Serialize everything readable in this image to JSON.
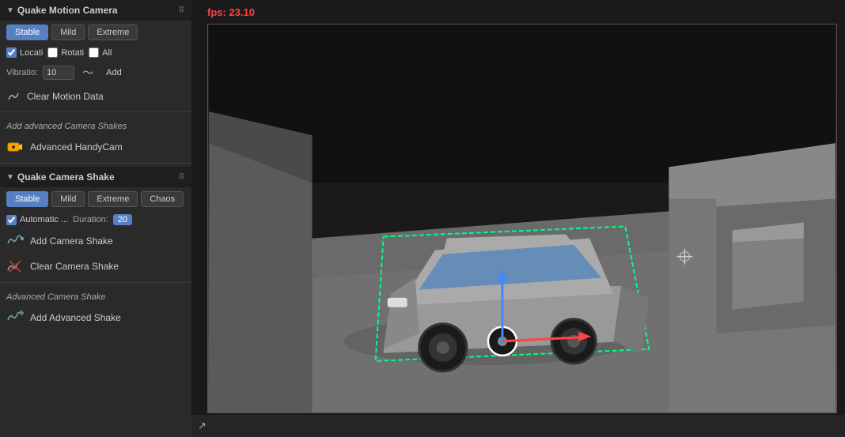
{
  "app": {
    "title": "Quake Motion Camera"
  },
  "fps": {
    "label": "fps:",
    "value": "23.10",
    "display": "fps: 23.10"
  },
  "quake_motion_section": {
    "title": "Quake Motion Camera",
    "drag_handle": "⠿",
    "tabs": [
      {
        "id": "stable",
        "label": "Stable",
        "active": true
      },
      {
        "id": "mild",
        "label": "Mild",
        "active": false
      },
      {
        "id": "extreme",
        "label": "Extreme",
        "active": false
      }
    ],
    "checkboxes": [
      {
        "id": "locati",
        "label": "Locati",
        "checked": true
      },
      {
        "id": "rotati",
        "label": "Rotati",
        "checked": false
      },
      {
        "id": "all",
        "label": "All",
        "checked": false
      }
    ],
    "vibration": {
      "label": "Vibratio:",
      "value": "10"
    },
    "add_button": "Add",
    "clear_motion": {
      "label": "Clear Motion Data",
      "icon": "curve-icon"
    }
  },
  "add_advanced_shakes": {
    "title": "Add advanced Camera Shakes",
    "handy_cam": {
      "label": "Advanced HandyCam",
      "icon": "camera-icon"
    }
  },
  "quake_camera_shake": {
    "title": "Quake Camera Shake",
    "drag_handle": "⠿",
    "tabs": [
      {
        "id": "stable",
        "label": "Stable",
        "active": true
      },
      {
        "id": "mild",
        "label": "Mild",
        "active": false
      },
      {
        "id": "extreme",
        "label": "Extreme",
        "active": false
      },
      {
        "id": "chaos",
        "label": "Chaos",
        "active": false
      }
    ],
    "section_label": "Mild Extreme Chaos",
    "automatic": {
      "label": "Automatic ...",
      "checked": true
    },
    "duration": {
      "label": "Duration:",
      "value": "20"
    },
    "add_shake": {
      "label": "Add Camera Shake",
      "icon": "add-shake-icon"
    },
    "clear_shake": {
      "label": "Clear Camera Shake",
      "icon": "clear-shake-icon"
    }
  },
  "advanced_camera_shake": {
    "title": "Advanced Camera Shake",
    "add_advanced": {
      "label": "Add Advanced Shake",
      "icon": "add-advanced-icon"
    }
  },
  "colors": {
    "active_tab": "#5680c2",
    "fps_color": "#ff4444",
    "panel_bg": "#2a2a2a",
    "border": "#555555"
  }
}
